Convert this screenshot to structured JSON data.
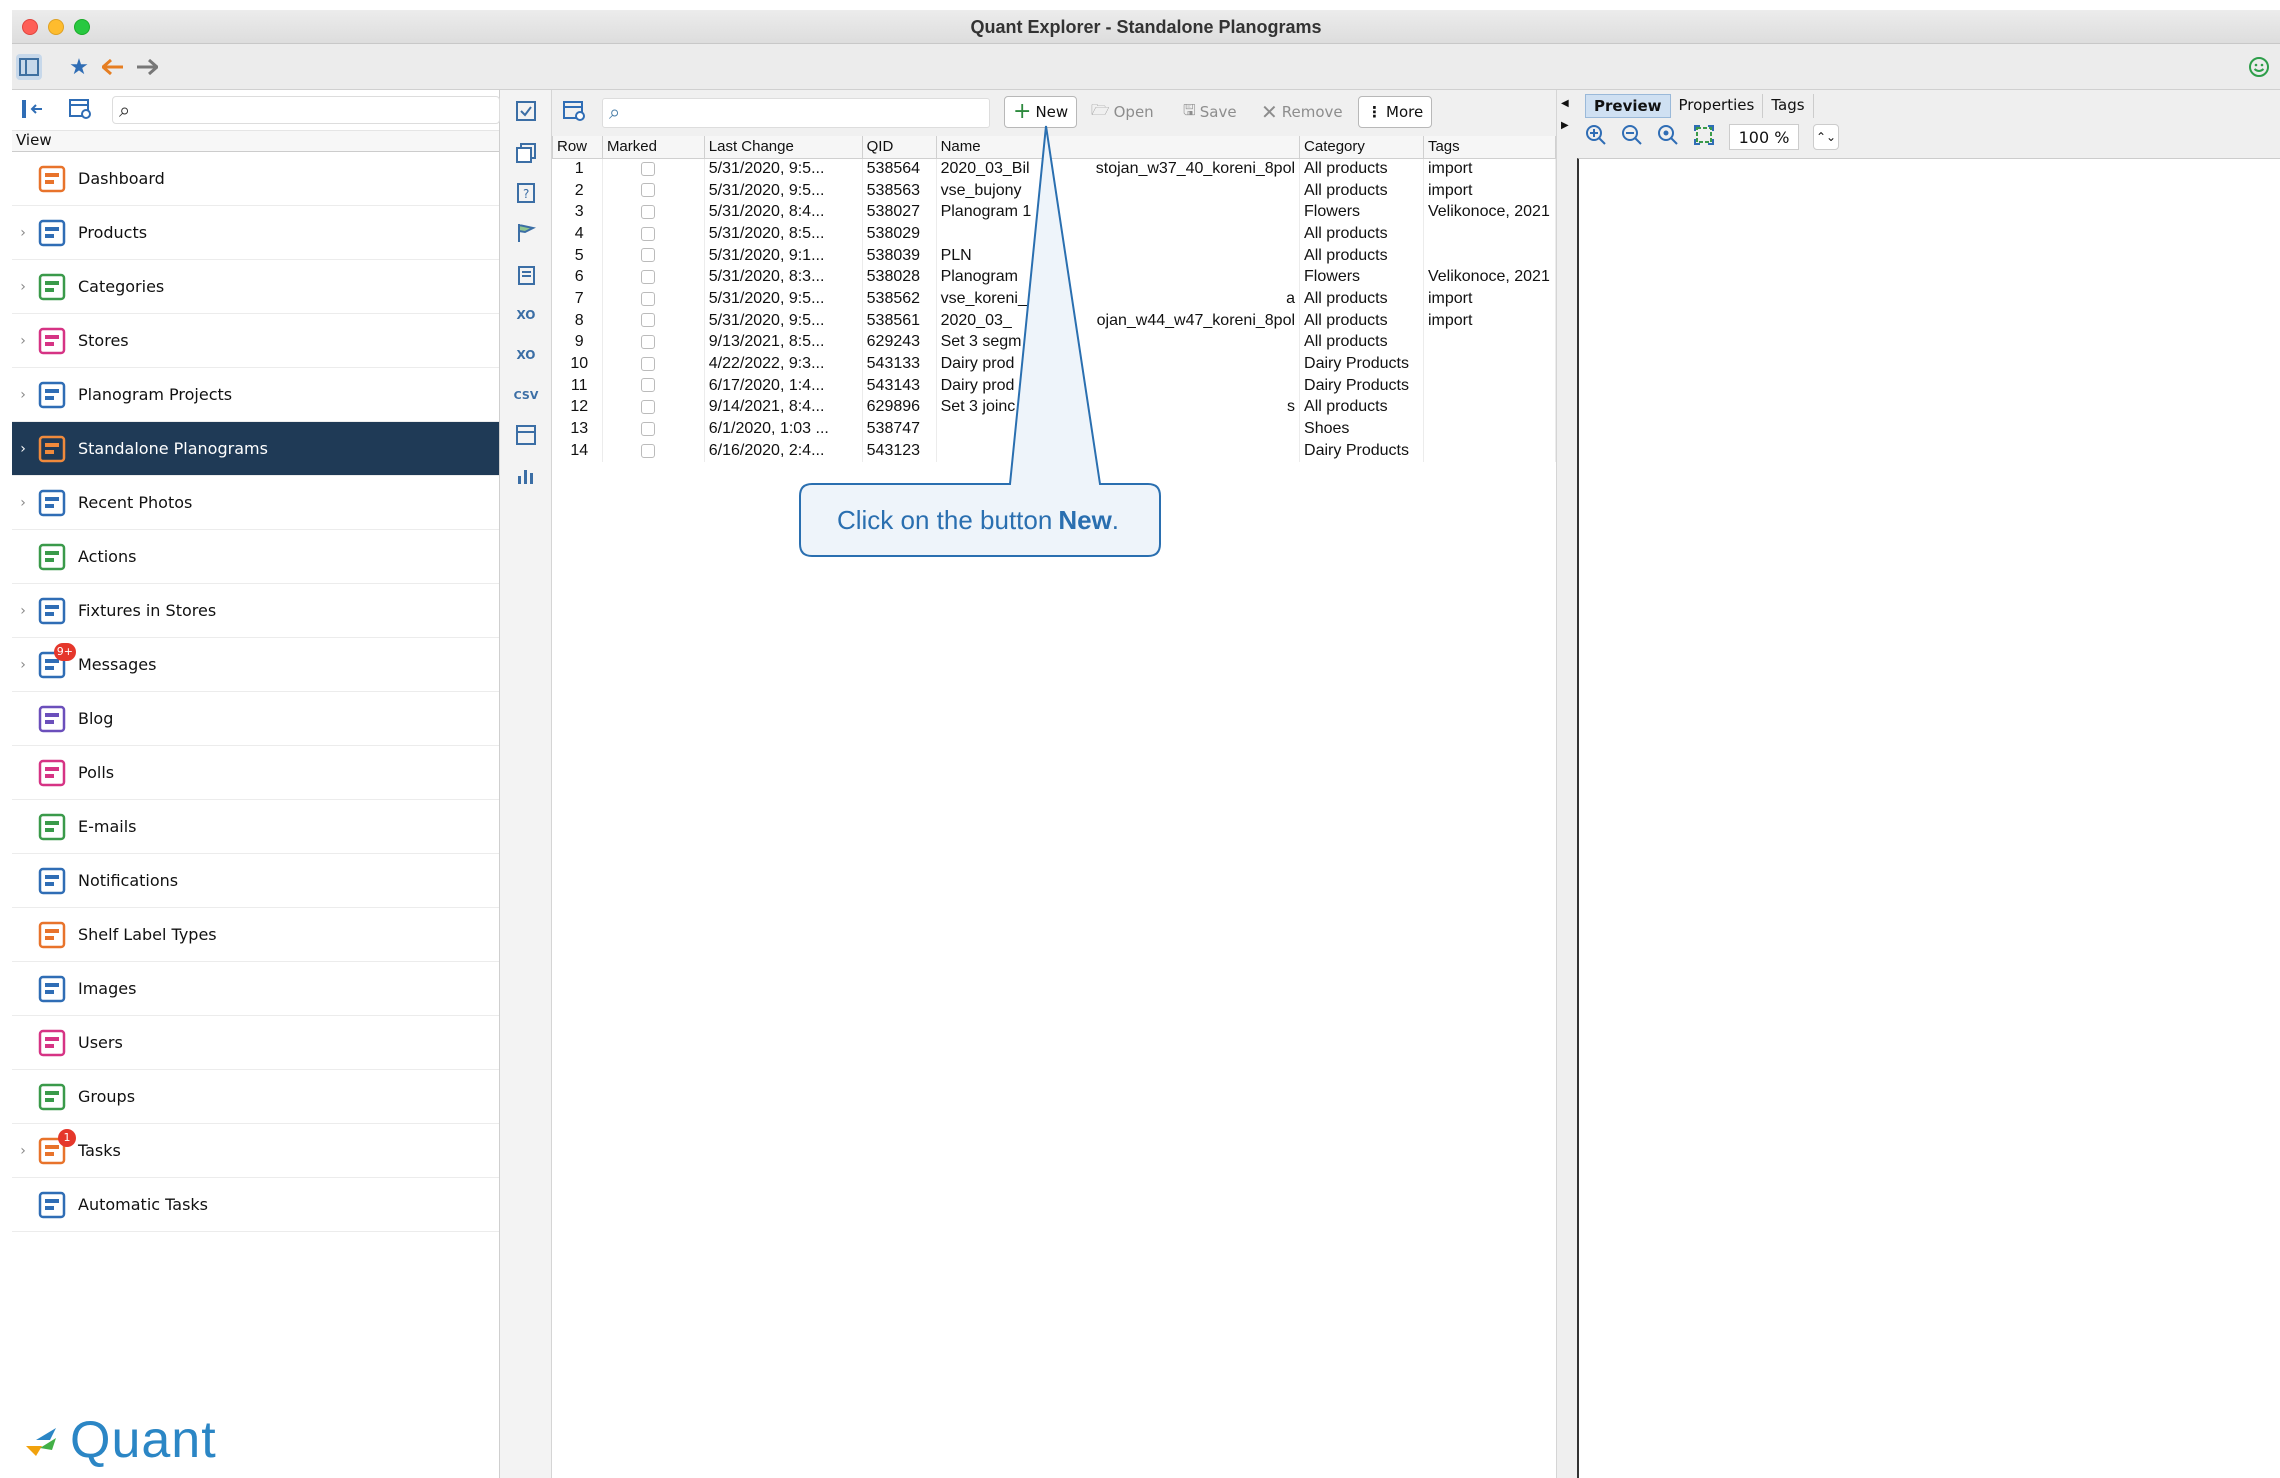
{
  "window": {
    "title": "Quant Explorer - Standalone Planograms"
  },
  "sidebar": {
    "view_label": "View",
    "items": [
      {
        "label": "Dashboard",
        "icon": "dashboard-icon",
        "chevron": false
      },
      {
        "label": "Products",
        "icon": "products-icon",
        "chevron": true
      },
      {
        "label": "Categories",
        "icon": "categories-icon",
        "chevron": true
      },
      {
        "label": "Stores",
        "icon": "stores-icon",
        "chevron": true
      },
      {
        "label": "Planogram Projects",
        "icon": "planogram-projects-icon",
        "chevron": true
      },
      {
        "label": "Standalone Planograms",
        "icon": "standalone-planograms-icon",
        "chevron": true,
        "selected": true
      },
      {
        "label": "Recent Photos",
        "icon": "camera-icon",
        "chevron": true
      },
      {
        "label": "Actions",
        "icon": "actions-icon",
        "chevron": false
      },
      {
        "label": "Fixtures in Stores",
        "icon": "fixtures-icon",
        "chevron": true
      },
      {
        "label": "Messages",
        "icon": "messages-icon",
        "chevron": true,
        "badge": "9+"
      },
      {
        "label": "Blog",
        "icon": "blog-icon",
        "chevron": false
      },
      {
        "label": "Polls",
        "icon": "polls-icon",
        "chevron": false
      },
      {
        "label": "E-mails",
        "icon": "email-icon",
        "chevron": false
      },
      {
        "label": "Notifications",
        "icon": "notifications-icon",
        "chevron": false
      },
      {
        "label": "Shelf Label Types",
        "icon": "shelf-label-icon",
        "chevron": false
      },
      {
        "label": "Images",
        "icon": "images-icon",
        "chevron": false
      },
      {
        "label": "Users",
        "icon": "users-icon",
        "chevron": false
      },
      {
        "label": "Groups",
        "icon": "groups-icon",
        "chevron": false
      },
      {
        "label": "Tasks",
        "icon": "tasks-icon",
        "chevron": true,
        "badge": "1"
      },
      {
        "label": "Automatic Tasks",
        "icon": "automatic-tasks-icon",
        "chevron": false
      }
    ],
    "logo_text": "Quant"
  },
  "toolbar": {
    "new_label": "New",
    "open_label": "Open",
    "save_label": "Save",
    "remove_label": "Remove",
    "more_label": "More"
  },
  "table": {
    "columns": [
      "Row",
      "Marked",
      "Last Change",
      "QID",
      "Name",
      "Category",
      "Tags"
    ],
    "rows": [
      [
        "1",
        "",
        "5/31/2020, 9:5...",
        "538564",
        "2020_03_Bil",
        "All products",
        "import",
        "stojan_w37_40_koreni_8pol"
      ],
      [
        "2",
        "",
        "5/31/2020, 9:5...",
        "538563",
        "vse_bujony",
        "All products",
        "import",
        ""
      ],
      [
        "3",
        "",
        "5/31/2020, 8:4...",
        "538027",
        "Planogram 1",
        "Flowers",
        "Velikonoce, 2021",
        ""
      ],
      [
        "4",
        "",
        "5/31/2020, 8:5...",
        "538029",
        "",
        "All products",
        "",
        ""
      ],
      [
        "5",
        "",
        "5/31/2020, 9:1...",
        "538039",
        "PLN",
        "All products",
        "",
        ""
      ],
      [
        "6",
        "",
        "5/31/2020, 8:3...",
        "538028",
        "Planogram",
        "Flowers",
        "Velikonoce, 2021",
        ""
      ],
      [
        "7",
        "",
        "5/31/2020, 9:5...",
        "538562",
        "vse_koreni_",
        "All products",
        "import",
        "a"
      ],
      [
        "8",
        "",
        "5/31/2020, 9:5...",
        "538561",
        "2020_03_",
        "All products",
        "import",
        "ojan_w44_w47_koreni_8pol"
      ],
      [
        "9",
        "",
        "9/13/2021, 8:5...",
        "629243",
        "Set 3 segm",
        "All products",
        "",
        ""
      ],
      [
        "10",
        "",
        "4/22/2022, 9:3...",
        "543133",
        "Dairy prod",
        "Dairy Products",
        "",
        ""
      ],
      [
        "11",
        "",
        "6/17/2020, 1:4...",
        "543143",
        "Dairy prod",
        "Dairy Products",
        "",
        ""
      ],
      [
        "12",
        "",
        "9/14/2021, 8:4...",
        "629896",
        "Set 3 joinc",
        "All products",
        "",
        "s"
      ],
      [
        "13",
        "",
        "6/1/2020, 1:03 ...",
        "538747",
        "",
        "Shoes",
        "",
        ""
      ],
      [
        "14",
        "",
        "6/16/2020, 2:4...",
        "543123",
        "",
        "Dairy Products",
        "",
        ""
      ]
    ]
  },
  "callout": {
    "prefix": "Click on the button",
    "target": "New",
    "suffix": "."
  },
  "preview": {
    "tabs": [
      "Preview",
      "Properties",
      "Tags"
    ],
    "active_tab": "Preview",
    "zoom": "100 %"
  },
  "colors": {
    "selected_bg": "#1f3a56",
    "callout_border": "#2a6fb0",
    "callout_bg": "#eef4fa",
    "badge": "#e5372b",
    "logo": "#2b86c5"
  }
}
